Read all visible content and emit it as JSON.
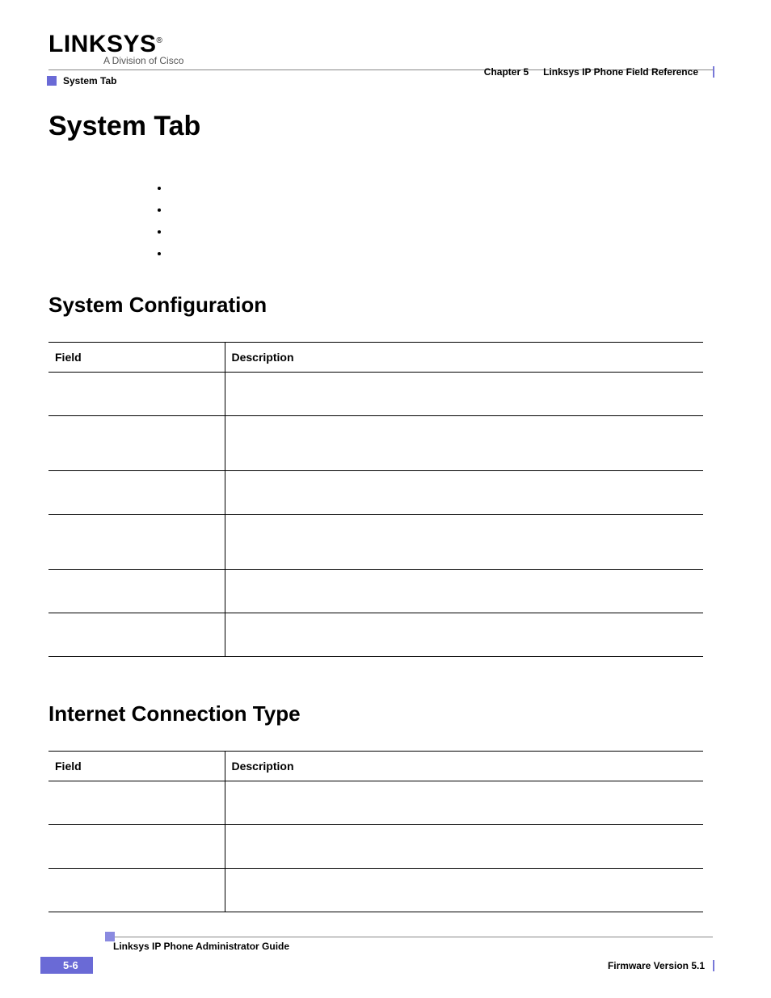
{
  "logo": {
    "brand": "LINKSYS",
    "reg": "®",
    "sub": "A Division of Cisco"
  },
  "header": {
    "chapter": "Chapter 5",
    "title": "Linksys IP Phone Field Reference"
  },
  "breadcrumb": "System Tab",
  "page_title": "System Tab",
  "bullets": [
    "",
    "",
    "",
    ""
  ],
  "section1": {
    "title": "System Configuration",
    "headers": {
      "field": "Field",
      "desc": "Description"
    }
  },
  "section2": {
    "title": "Internet Connection Type",
    "headers": {
      "field": "Field",
      "desc": "Description"
    }
  },
  "footer": {
    "guide": "Linksys IP Phone Administrator Guide",
    "pagenum": "5-6",
    "firmware": "Firmware Version 5.1"
  }
}
